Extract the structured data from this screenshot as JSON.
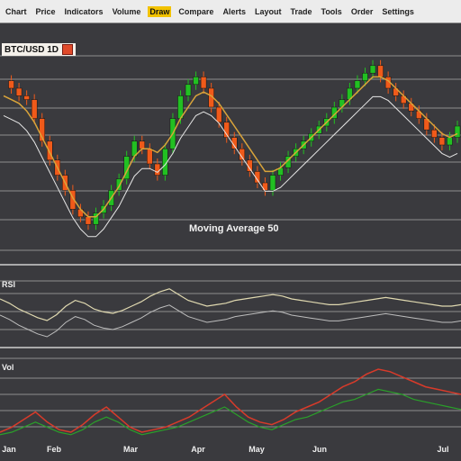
{
  "topbar": {
    "items": [
      "Chart",
      "Price",
      "Indicators",
      "Volume",
      "Draw",
      "Compare",
      "Alerts",
      "Layout",
      "Trade",
      "Tools",
      "Order",
      "Settings"
    ],
    "active_index": 4
  },
  "chart_header": {
    "title": "BTC/USD 1D"
  },
  "main_chart": {
    "mid_label": "Moving Average 50"
  },
  "oscillator": {
    "label": "RSI"
  },
  "volume": {
    "label": "Vol"
  },
  "x_axis": {
    "ticks": [
      "Jan",
      "Feb",
      "Mar",
      "Apr",
      "May",
      "Jun",
      "Jul"
    ]
  },
  "colors": {
    "up": "#22c022",
    "down": "#f05a1a",
    "ma_line": "#d9a43a",
    "white_line": "#e6e6e6",
    "volume_red": "#d83a2a",
    "volume_green": "#2aa02a"
  },
  "chart_data": {
    "type": "candlestick",
    "x": [
      1,
      2,
      3,
      4,
      5,
      6,
      7,
      8,
      9,
      10,
      11,
      12,
      13,
      14,
      15,
      16,
      17,
      18,
      19,
      20,
      21,
      22,
      23,
      24,
      25,
      26,
      27,
      28,
      29,
      30,
      31,
      32,
      33,
      34,
      35,
      36,
      37,
      38,
      39,
      40,
      41,
      42,
      43,
      44,
      45,
      46,
      47,
      48,
      49,
      50,
      51,
      52,
      53,
      54,
      55,
      56,
      57,
      58,
      59,
      60
    ],
    "close": [
      62,
      60,
      58,
      57,
      52,
      46,
      41,
      37,
      33,
      28,
      26,
      24,
      27,
      29,
      33,
      36,
      42,
      46,
      44,
      40,
      37,
      44,
      52,
      58,
      61,
      63,
      60,
      55,
      51,
      47,
      44,
      41,
      38,
      35,
      33,
      37,
      39,
      42,
      44,
      46,
      48,
      50,
      52,
      55,
      57,
      60,
      62,
      64,
      66,
      63,
      60,
      58,
      56,
      54,
      52,
      49,
      47,
      45,
      47,
      50
    ],
    "ma_fast": [
      58,
      57,
      56,
      54,
      51,
      47,
      43,
      39,
      35,
      31,
      28,
      26,
      26,
      28,
      31,
      34,
      38,
      42,
      44,
      44,
      43,
      45,
      48,
      52,
      55,
      58,
      59,
      58,
      56,
      53,
      50,
      47,
      44,
      41,
      38,
      38,
      39,
      41,
      43,
      45,
      47,
      49,
      51,
      53,
      55,
      57,
      59,
      61,
      63,
      63,
      62,
      60,
      58,
      56,
      54,
      52,
      50,
      48,
      47,
      48
    ],
    "rsi": [
      55,
      52,
      48,
      45,
      42,
      40,
      44,
      50,
      54,
      52,
      48,
      46,
      45,
      47,
      50,
      53,
      57,
      60,
      62,
      58,
      54,
      52,
      50,
      51,
      52,
      54,
      55,
      56,
      57,
      58,
      57,
      55,
      54,
      53,
      52,
      51,
      51,
      52,
      53,
      54,
      55,
      56,
      55,
      54,
      53,
      52,
      51,
      50,
      50,
      51
    ],
    "volume_red": [
      10,
      14,
      20,
      26,
      18,
      12,
      10,
      16,
      24,
      30,
      22,
      14,
      10,
      12,
      14,
      18,
      22,
      28,
      34,
      40,
      30,
      22,
      18,
      16,
      20,
      26,
      30,
      34,
      40,
      46,
      50,
      56,
      60,
      58,
      54,
      50,
      46,
      44,
      42,
      40
    ],
    "volume_green": [
      8,
      10,
      14,
      18,
      14,
      10,
      8,
      12,
      18,
      22,
      18,
      12,
      8,
      10,
      12,
      14,
      18,
      22,
      26,
      30,
      24,
      18,
      14,
      12,
      16,
      20,
      22,
      26,
      30,
      34,
      36,
      40,
      44,
      42,
      40,
      36,
      34,
      32,
      30,
      28
    ]
  }
}
